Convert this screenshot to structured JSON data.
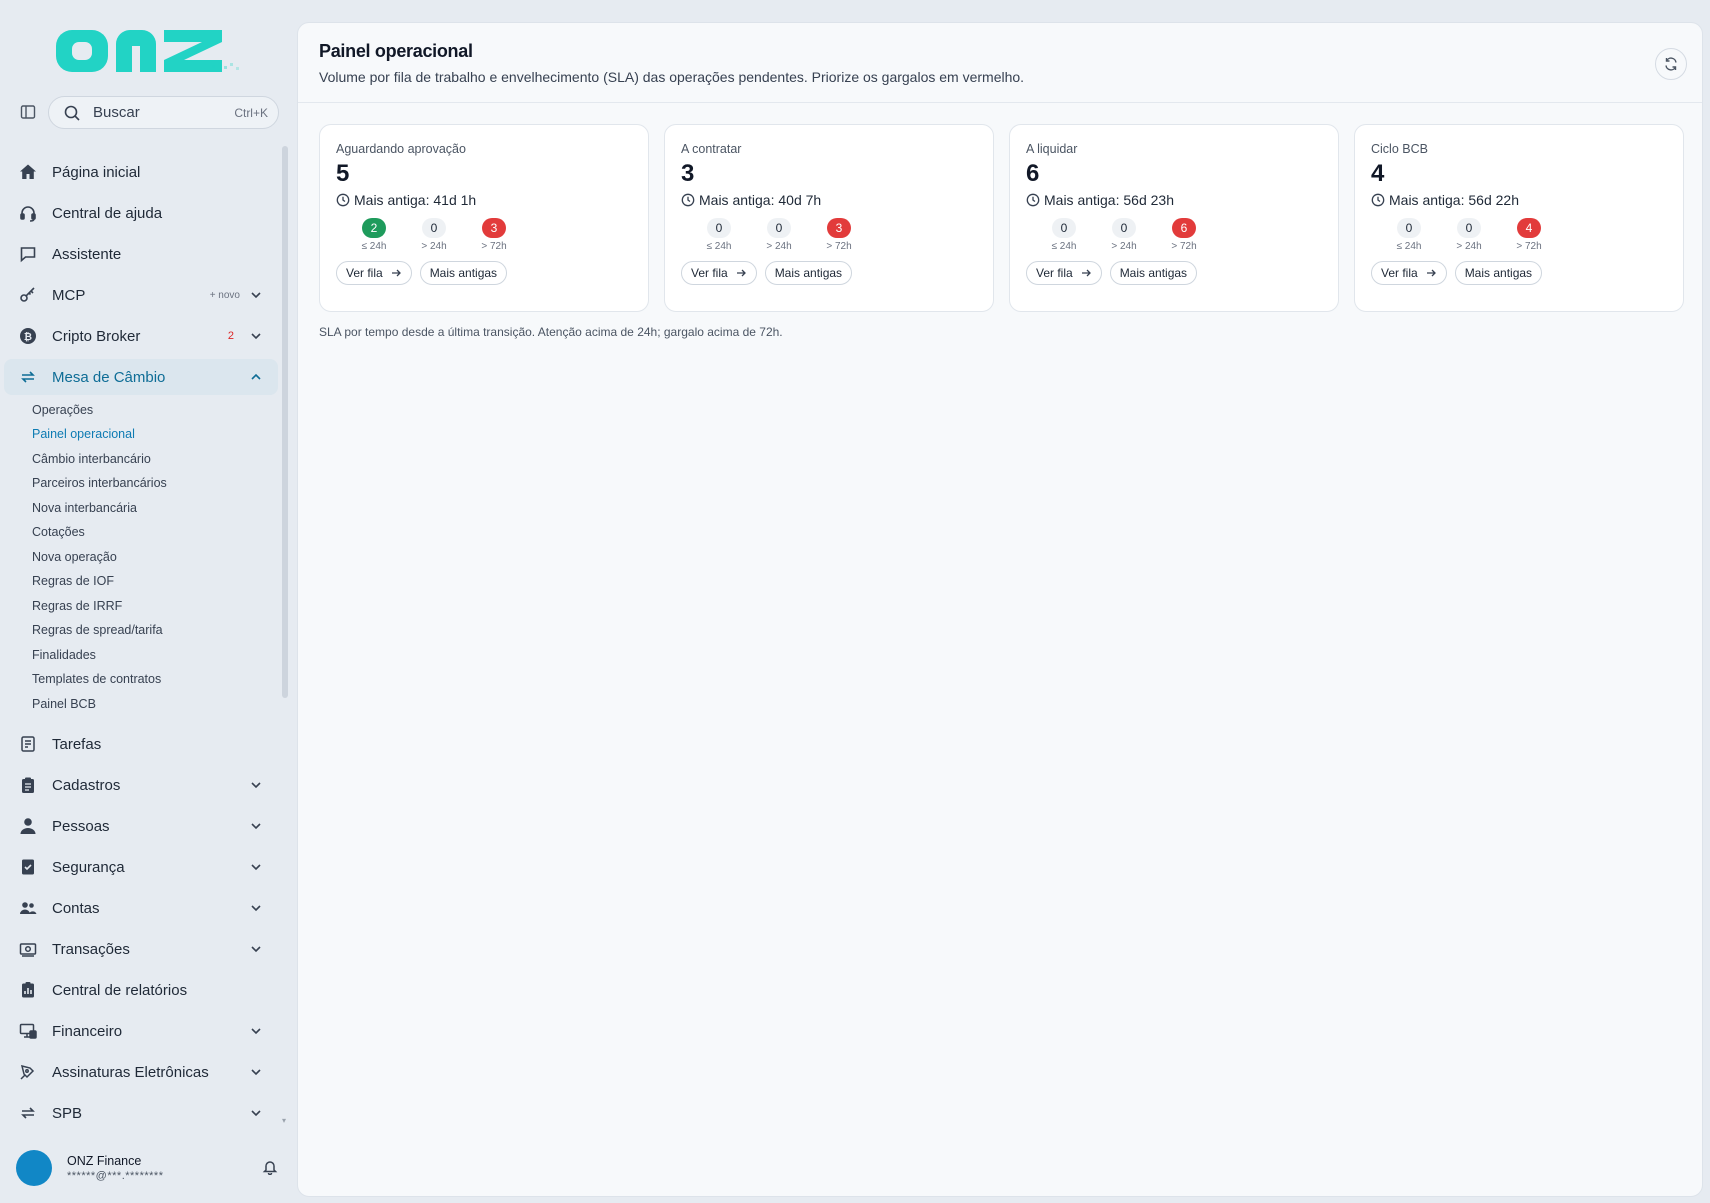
{
  "brand": {
    "logo_text": "onz",
    "accent": "#22d3c5"
  },
  "search": {
    "placeholder": "Buscar",
    "shortcut": "Ctrl+K"
  },
  "nav": {
    "pagina_inicial": "Página inicial",
    "central_ajuda": "Central de ajuda",
    "assistente": "Assistente",
    "mcp": "MCP",
    "mcp_extra": "+ novo",
    "cripto_broker": "Cripto Broker",
    "cripto_broker_badge": "2",
    "mesa_cambio": "Mesa de Câmbio",
    "mesa_sub": [
      "Operações",
      "Painel operacional",
      "Câmbio interbancário",
      "Parceiros interbancários",
      "Nova interbancária",
      "Cotações",
      "Nova operação",
      "Regras de IOF",
      "Regras de IRRF",
      "Regras de spread/tarifa",
      "Finalidades",
      "Templates de contratos",
      "Painel BCB"
    ],
    "tarefas": "Tarefas",
    "cadastros": "Cadastros",
    "pessoas": "Pessoas",
    "seguranca": "Segurança",
    "contas": "Contas",
    "transacoes": "Transações",
    "central_relatorios": "Central de relatórios",
    "financeiro": "Financeiro",
    "assinaturas": "Assinaturas Eletrônicas",
    "spb": "SPB"
  },
  "user": {
    "name": "ONZ Finance",
    "email": "******@***.********"
  },
  "page": {
    "title": "Painel operacional",
    "subtitle": "Volume por fila de trabalho e envelhecimento (SLA) das operações pendentes. Priorize os gargalos em vermelho.",
    "footnote": "SLA por tempo desde a última transição. Atenção acima de 24h; gargalo acima de 72h."
  },
  "labels": {
    "bucket_1": "≤ 24h",
    "bucket_2": "> 24h",
    "bucket_3": "> 72h",
    "ver_fila": "Ver fila",
    "mais_antigas": "Mais antigas"
  },
  "cards": [
    {
      "title": "Aguardando aprovação",
      "count": "5",
      "oldest": "Mais antiga: 41d 1h",
      "b1": "2",
      "b2": "0",
      "b3": "3"
    },
    {
      "title": "A contratar",
      "count": "3",
      "oldest": "Mais antiga: 40d 7h",
      "b1": "0",
      "b2": "0",
      "b3": "3"
    },
    {
      "title": "A liquidar",
      "count": "6",
      "oldest": "Mais antiga: 56d 23h",
      "b1": "0",
      "b2": "0",
      "b3": "6"
    },
    {
      "title": "Ciclo BCB",
      "count": "4",
      "oldest": "Mais antiga: 56d 22h",
      "b1": "0",
      "b2": "0",
      "b3": "4"
    }
  ],
  "colors": {
    "active_nav": "#0e6d96",
    "sla_ok": "#1e9b5c",
    "sla_bottleneck": "#e23b3b"
  }
}
